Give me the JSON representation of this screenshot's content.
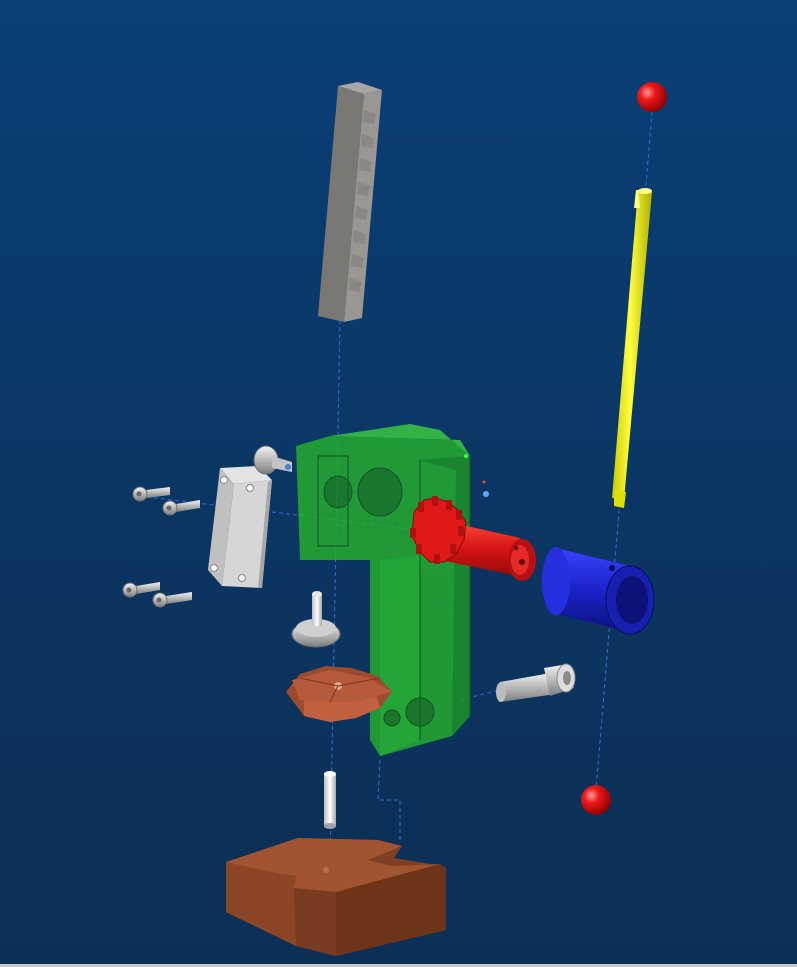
{
  "viewport": {
    "background_top": "#0a3f78",
    "background_bottom": "#0c2f55",
    "axis_line_color": "#2a6fe0"
  },
  "parts": {
    "rack": {
      "icon": "gear-rack-icon",
      "color": "#7f7c79"
    },
    "top_ball": {
      "icon": "ball-knob-icon",
      "color": "#e01010"
    },
    "bottom_ball": {
      "icon": "ball-knob-icon",
      "color": "#e01010"
    },
    "handle_rod": {
      "icon": "rod-icon",
      "color": "#f2f200"
    },
    "frame": {
      "icon": "frame-body-icon",
      "color": "#2bc62b"
    },
    "pinion_shaft": {
      "icon": "pinion-gear-icon",
      "color": "#dd1a1a"
    },
    "hub": {
      "icon": "bushing-icon",
      "color": "#1a22c8"
    },
    "cover_plate": {
      "icon": "plate-icon",
      "color": "#d4d4d4"
    },
    "screws": {
      "icon": "screw-icon",
      "color": "#bdbdbd"
    },
    "shoulder_bolt": {
      "icon": "bolt-icon",
      "color": "#cfcfcf"
    },
    "knob_stud": {
      "icon": "stud-icon",
      "color": "#b8b8b8"
    },
    "star_knob": {
      "icon": "star-knob-icon",
      "color": "#b55a3b"
    },
    "pin": {
      "icon": "pin-icon",
      "color": "#e6e6e6"
    },
    "base": {
      "icon": "base-block-icon",
      "color": "#8a4a2a"
    },
    "side_bolt": {
      "icon": "bolt-icon",
      "color": "#b8b8b8"
    }
  }
}
